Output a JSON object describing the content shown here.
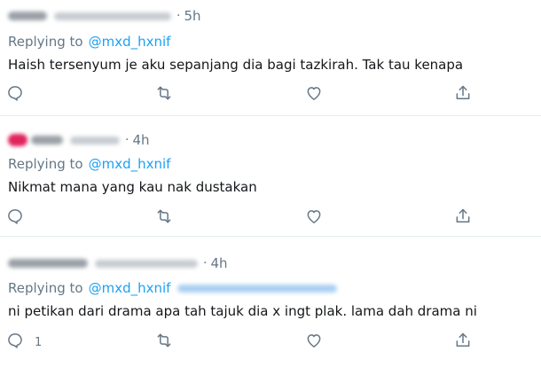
{
  "tweets": [
    {
      "name": "",
      "handle": "",
      "time": "5h",
      "replying_label": "Replying to",
      "replying_handle": "@mxd_hxnif",
      "extra_handle": "",
      "text": "Haish tersenyum je aku sepanjang dia bagi tazkirah. Tak tau kenapa",
      "reply_count": ""
    },
    {
      "name": "",
      "handle": "",
      "time": "4h",
      "replying_label": "Replying to",
      "replying_handle": "@mxd_hxnif",
      "extra_handle": "",
      "text": "Nikmat mana yang kau nak dustakan",
      "reply_count": ""
    },
    {
      "name": "",
      "handle": "",
      "time": "4h",
      "replying_label": "Replying to",
      "replying_handle": "@mxd_hxnif",
      "extra_handle": "",
      "text": "ni petikan dari drama apa tah tajuk dia x ingt plak. lama dah drama ni",
      "reply_count": "1"
    }
  ],
  "separator": "·",
  "icons": {
    "reply": "reply-icon",
    "retweet": "retweet-icon",
    "like": "heart-icon",
    "share": "share-icon"
  },
  "colors": {
    "text": "#14171a",
    "secondary": "#657786",
    "link": "#1da1f2",
    "divider": "#e6ecf0"
  }
}
